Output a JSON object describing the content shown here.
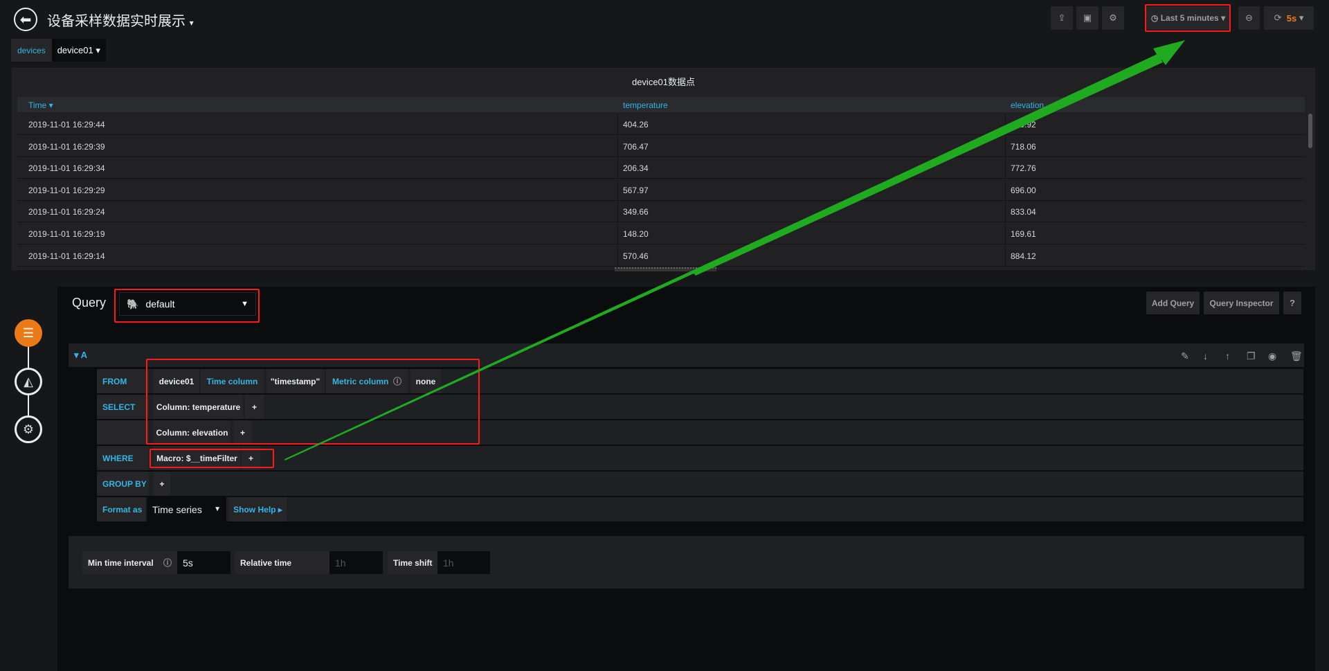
{
  "header": {
    "title": "设备采样数据实时展示",
    "time_range": "Last 5 minutes",
    "refresh_interval": "5s"
  },
  "variables": [
    {
      "label": "devices",
      "value": "device01"
    }
  ],
  "table_panel": {
    "title": "device01数据点",
    "columns": [
      "Time",
      "temperature",
      "elevation"
    ],
    "rows": [
      [
        "2019-11-01 16:29:44",
        "404.26",
        "140.92"
      ],
      [
        "2019-11-01 16:29:39",
        "706.47",
        "718.06"
      ],
      [
        "2019-11-01 16:29:34",
        "206.34",
        "772.76"
      ],
      [
        "2019-11-01 16:29:29",
        "567.97",
        "696.00"
      ],
      [
        "2019-11-01 16:29:24",
        "349.66",
        "833.04"
      ],
      [
        "2019-11-01 16:29:19",
        "148.20",
        "169.61"
      ],
      [
        "2019-11-01 16:29:14",
        "570.46",
        "884.12"
      ]
    ]
  },
  "query_editor": {
    "label": "Query",
    "datasource": "default",
    "add_query": "Add Query",
    "query_inspector": "Query Inspector",
    "help": "?",
    "query_ref": "A",
    "from": {
      "label": "FROM",
      "table": "device01",
      "time_column_label": "Time column",
      "time_column": "\"timestamp\"",
      "metric_column_label": "Metric column",
      "metric_column": "none"
    },
    "select": {
      "label": "SELECT",
      "columns": [
        "Column: temperature",
        "Column: elevation"
      ]
    },
    "where": {
      "label": "WHERE",
      "value": "Macro: $__timeFilter"
    },
    "group_by": {
      "label": "GROUP BY"
    },
    "format": {
      "label": "Format as",
      "value": "Time series",
      "show_help": "Show Help"
    },
    "plus": "+"
  },
  "options": {
    "min_interval_label": "Min time interval",
    "min_interval": "5s",
    "relative_time_label": "Relative time",
    "relative_time_placeholder": "1h",
    "time_shift_label": "Time shift",
    "time_shift_placeholder": "1h"
  },
  "colors": {
    "accent": "#33b5e5",
    "annotation_box": "#ff1a1a",
    "arrow": "#1faa1f",
    "refresh": "#eb7b18"
  }
}
